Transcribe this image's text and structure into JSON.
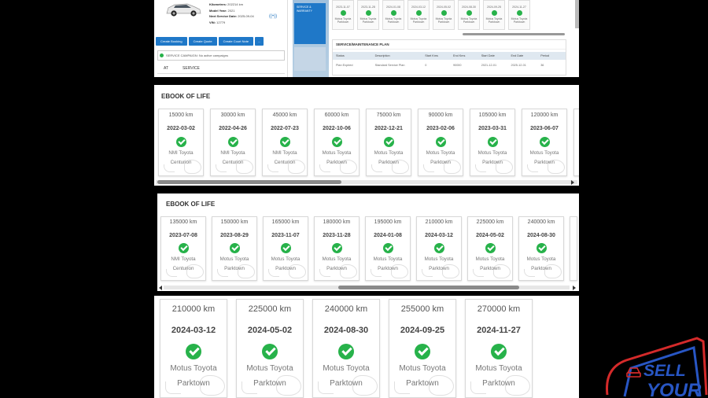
{
  "vehicle_summary": {
    "fields": [
      {
        "label": "Kilometres:",
        "value": "202214 km"
      },
      {
        "label": "Model Year:",
        "value": "2021"
      },
      {
        "label": "Next Service Date:",
        "value": "2025-09-04"
      },
      {
        "label": "VIN:",
        "value": "12779"
      }
    ],
    "buttons": [
      "Create Booking",
      "Create Quote",
      "Create Court Note",
      "..."
    ],
    "campaign_text": "SERVICE CAMPAIGN: No active campaigns",
    "tabs": [
      "AT",
      "SERVICE"
    ],
    "side_tile_text": "SERVICE & WARRANTY"
  },
  "top_mini_dates": [
    "2023-11-07",
    "2023-11-28",
    "2024-01-08",
    "2024-03-12",
    "2024-05-02",
    "2024-08-30",
    "2024-09-25",
    "2024-11-27"
  ],
  "top_mini_dealer": "Motus Toyota Parktown",
  "service_plan": {
    "title": "SERVICE/MAINTENANCE PLAN",
    "columns": [
      "Status",
      "Description",
      "Start Kms",
      "End Kms",
      "Start Date",
      "End Date",
      "Period"
    ],
    "rows": [
      [
        "Plan Expired",
        "Standard Service Plan",
        "0",
        "90000",
        "2021-12-01",
        "2025-12-01",
        "36"
      ]
    ]
  },
  "ebook1": {
    "title": "EBOOK OF LIFE",
    "entries": [
      {
        "km": "15000 km",
        "date": "2022-03-02",
        "dealer_line1": "NMI Toyota",
        "dealer_line2": "Centurion"
      },
      {
        "km": "30000 km",
        "date": "2022-04-26",
        "dealer_line1": "NMI Toyota",
        "dealer_line2": "Centurion"
      },
      {
        "km": "45000 km",
        "date": "2022-07-23",
        "dealer_line1": "NMI Toyota",
        "dealer_line2": "Centurion"
      },
      {
        "km": "60000 km",
        "date": "2022-10-06",
        "dealer_line1": "Motus Toyota",
        "dealer_line2": "Parktown"
      },
      {
        "km": "75000 km",
        "date": "2022-12-21",
        "dealer_line1": "Motus Toyota",
        "dealer_line2": "Parktown"
      },
      {
        "km": "90000 km",
        "date": "2023-02-06",
        "dealer_line1": "Motus Toyota",
        "dealer_line2": "Parktown"
      },
      {
        "km": "105000 km",
        "date": "2023-03-31",
        "dealer_line1": "Motus Toyota",
        "dealer_line2": "Parktown"
      },
      {
        "km": "120000 km",
        "date": "2023-06-07",
        "dealer_line1": "Motus Toyota",
        "dealer_line2": "Parktown"
      }
    ]
  },
  "ebook2": {
    "title": "EBOOK OF LIFE",
    "entries": [
      {
        "km": "135000 km",
        "date": "2023-07-08",
        "dealer_line1": "NMI Toyota",
        "dealer_line2": "Centurion"
      },
      {
        "km": "150000 km",
        "date": "2023-08-29",
        "dealer_line1": "Motus Toyota",
        "dealer_line2": "Parktown"
      },
      {
        "km": "165000 km",
        "date": "2023-11-07",
        "dealer_line1": "Motus Toyota",
        "dealer_line2": "Parktown"
      },
      {
        "km": "180000 km",
        "date": "2023-11-28",
        "dealer_line1": "Motus Toyota",
        "dealer_line2": "Parktown"
      },
      {
        "km": "195000 km",
        "date": "2024-01-08",
        "dealer_line1": "Motus Toyota",
        "dealer_line2": "Parktown"
      },
      {
        "km": "210000 km",
        "date": "2024-03-12",
        "dealer_line1": "Motus Toyota",
        "dealer_line2": "Parktown"
      },
      {
        "km": "225000 km",
        "date": "2024-05-02",
        "dealer_line1": "Motus Toyota",
        "dealer_line2": "Parktown"
      },
      {
        "km": "240000 km",
        "date": "2024-08-30",
        "dealer_line1": "Motus Toyota",
        "dealer_line2": "Parktown"
      }
    ]
  },
  "ebook3": {
    "entries": [
      {
        "km": "210000 km",
        "date": "2024-03-12",
        "dealer_line1": "Motus Toyota",
        "dealer_line2": "Parktown"
      },
      {
        "km": "225000 km",
        "date": "2024-05-02",
        "dealer_line1": "Motus Toyota",
        "dealer_line2": "Parktown"
      },
      {
        "km": "240000 km",
        "date": "2024-08-30",
        "dealer_line1": "Motus Toyota",
        "dealer_line2": "Parktown"
      },
      {
        "km": "255000 km",
        "date": "2024-09-25",
        "dealer_line1": "Motus Toyota",
        "dealer_line2": "Parktown"
      },
      {
        "km": "270000 km",
        "date": "2024-11-27",
        "dealer_line1": "Motus Toyota",
        "dealer_line2": "Parktown"
      }
    ]
  },
  "watermark": {
    "line1": "SELL",
    "line2": "YOUR"
  },
  "colors": {
    "check_green": "#27b24a",
    "button_blue": "#1f78c8",
    "logo_red": "#d42a2a",
    "logo_blue": "#2856c4"
  }
}
